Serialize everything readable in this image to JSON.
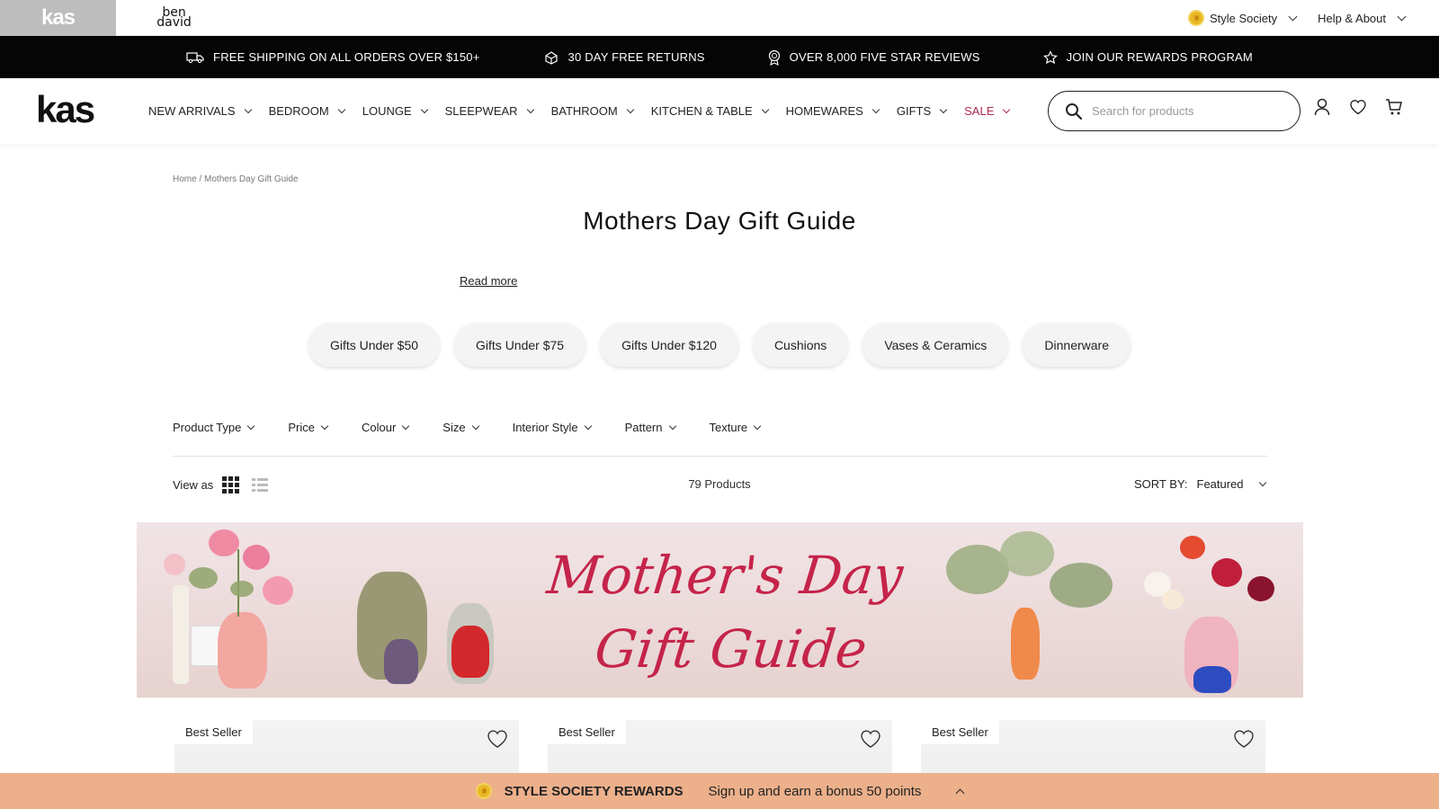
{
  "util_bar": {
    "brand_kas": "kas",
    "brand_ben_line1": "ben",
    "brand_ben_line2": "david",
    "style_society": "Style Society",
    "help_about": "Help & About"
  },
  "promo_bar": {
    "items": [
      {
        "icon": "truck-icon",
        "label": "FREE SHIPPING ON ALL ORDERS OVER $150+"
      },
      {
        "icon": "returns-icon",
        "label": "30 DAY FREE RETURNS"
      },
      {
        "icon": "award-icon",
        "label": "OVER 8,000 FIVE STAR REVIEWS"
      },
      {
        "icon": "star-icon",
        "label": "JOIN OUR REWARDS PROGRAM"
      }
    ]
  },
  "nav": {
    "logo": "kas",
    "links": [
      "NEW ARRIVALS",
      "BEDROOM",
      "LOUNGE",
      "SLEEPWEAR",
      "BATHROOM",
      "KITCHEN & TABLE",
      "HOMEWARES",
      "GIFTS",
      "SALE"
    ],
    "search_placeholder": "Search for products",
    "sale_color": "#b02a4d"
  },
  "breadcrumb": {
    "home": "Home",
    "separator": "/",
    "current": "Mothers Day Gift Guide"
  },
  "page": {
    "title": "Mothers Day Gift Guide",
    "read_more": "Read more"
  },
  "chips": [
    "Gifts Under $50",
    "Gifts Under $75",
    "Gifts Under $120",
    "Cushions",
    "Vases & Ceramics",
    "Dinnerware"
  ],
  "filters": [
    "Product Type",
    "Price",
    "Colour",
    "Size",
    "Interior Style",
    "Pattern",
    "Texture"
  ],
  "toolbar": {
    "view_as": "View as",
    "products_count": "79 Products",
    "sort_label": "SORT BY:",
    "sort_value": "Featured"
  },
  "banner": {
    "line1": "Mother's Day",
    "line2": "Gift Guide",
    "text_color": "#c5244a"
  },
  "products": [
    {
      "badge": "Best Seller"
    },
    {
      "badge": "Best Seller"
    },
    {
      "badge": "Best Seller"
    }
  ],
  "rewards_bar": {
    "title": "STYLE SOCIETY REWARDS",
    "message": "Sign up and earn a bonus 50 points",
    "background": "#ecb08b"
  }
}
